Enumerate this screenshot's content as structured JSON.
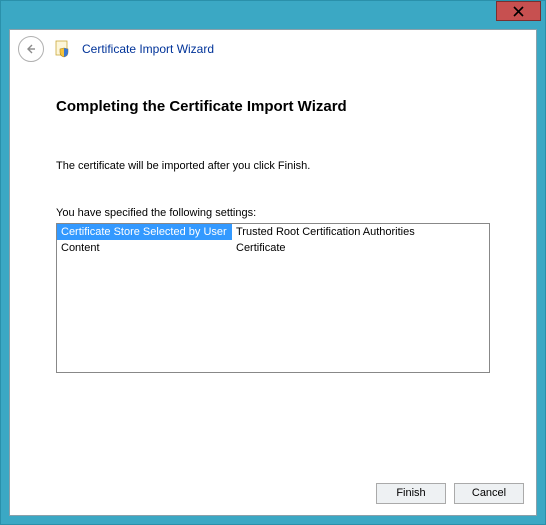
{
  "wizard": {
    "title": "Certificate Import Wizard"
  },
  "page": {
    "heading": "Completing the Certificate Import Wizard",
    "instruction": "The certificate will be imported after you click Finish.",
    "settings_label": "You have specified the following settings:",
    "settings": [
      {
        "key": "Certificate Store Selected by User",
        "value": "Trusted Root Certification Authorities",
        "selected": true
      },
      {
        "key": "Content",
        "value": "Certificate",
        "selected": false
      }
    ]
  },
  "buttons": {
    "finish": "Finish",
    "cancel": "Cancel"
  },
  "colors": {
    "accent": "#3ba8c4",
    "close": "#c75050",
    "title_link": "#003399",
    "selection": "#3399ff"
  }
}
